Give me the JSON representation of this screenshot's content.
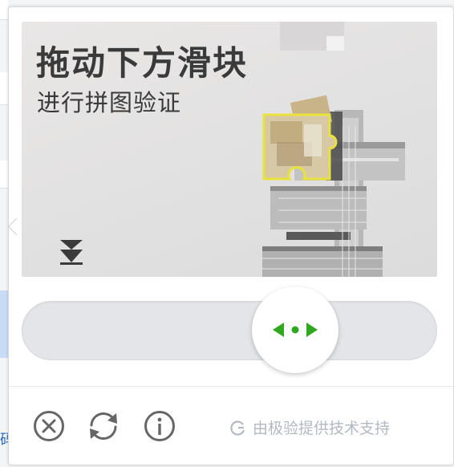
{
  "captcha": {
    "title": "拖动下方滑块",
    "subtitle": "进行拼图验证",
    "drag_hint_icon": "double-chevron-down-icon",
    "slider_handle_icon": "left-right-arrows-icon",
    "colors": {
      "accent": "#2fa820",
      "icon_gray": "#666666",
      "credit_gray": "#b3b9c2"
    }
  },
  "footer": {
    "close_icon": "close-circle-icon",
    "refresh_icon": "refresh-icon",
    "info_icon": "info-icon",
    "credit_icon": "geetest-logo-icon",
    "credit_text": "由极验提供技术支持"
  },
  "background_page": {
    "edge_text": "码"
  }
}
